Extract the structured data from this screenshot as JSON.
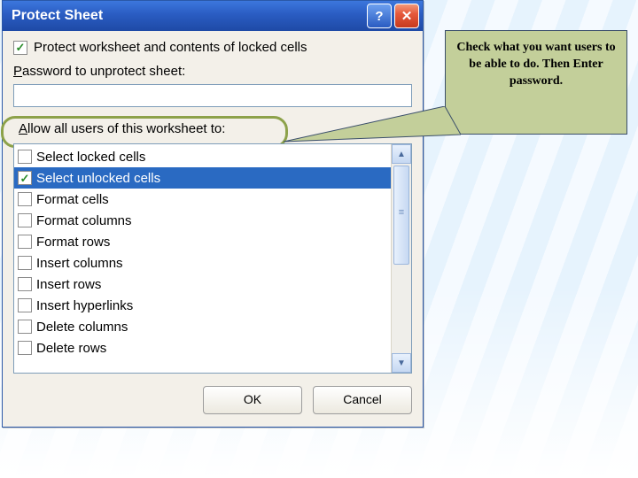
{
  "dialog": {
    "title": "Protect Sheet",
    "protect_checkbox": {
      "checked": true,
      "label": "Protect worksheet and contents of locked cells"
    },
    "password_label": "Password to unprotect sheet:",
    "password_value": "",
    "allow_label": "Allow all users of this worksheet to:",
    "permissions": [
      {
        "label": "Select locked cells",
        "checked": false,
        "selected": false
      },
      {
        "label": "Select unlocked cells",
        "checked": true,
        "selected": true
      },
      {
        "label": "Format cells",
        "checked": false,
        "selected": false
      },
      {
        "label": "Format columns",
        "checked": false,
        "selected": false
      },
      {
        "label": "Format rows",
        "checked": false,
        "selected": false
      },
      {
        "label": "Insert columns",
        "checked": false,
        "selected": false
      },
      {
        "label": "Insert rows",
        "checked": false,
        "selected": false
      },
      {
        "label": "Insert hyperlinks",
        "checked": false,
        "selected": false
      },
      {
        "label": "Delete columns",
        "checked": false,
        "selected": false
      },
      {
        "label": "Delete rows",
        "checked": false,
        "selected": false
      }
    ],
    "ok_label": "OK",
    "cancel_label": "Cancel"
  },
  "callout": {
    "text": "Check what you want users to be able to do. Then Enter password."
  }
}
